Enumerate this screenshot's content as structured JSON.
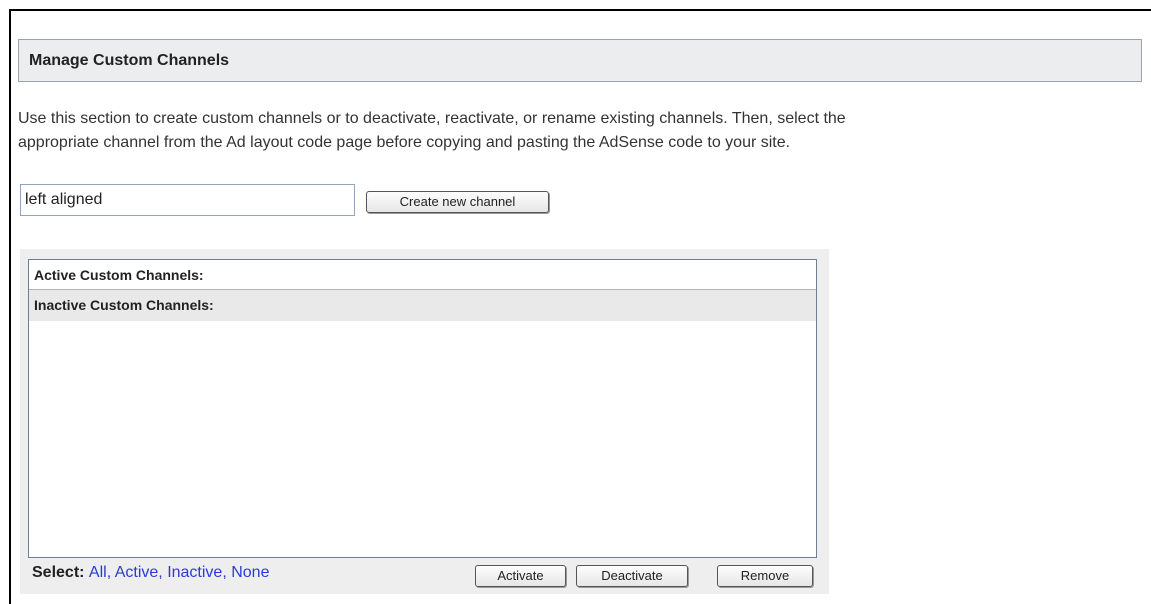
{
  "header": {
    "title": "Manage Custom Channels"
  },
  "description": {
    "line1": "Use this section to create custom channels or to deactivate, reactivate, or rename existing channels. Then, select the",
    "line2": "appropriate channel from the Ad layout code page before copying and pasting the AdSense code to your site."
  },
  "create": {
    "input_value": "left aligned",
    "button_label": "Create new channel"
  },
  "channels": {
    "active_label": "Active Custom Channels:",
    "inactive_label": "Inactive Custom Channels:"
  },
  "select": {
    "label": "Select:",
    "options": [
      "All",
      "Active",
      "Inactive",
      "None"
    ],
    "separator": ","
  },
  "actions": {
    "activate_label": "Activate",
    "deactivate_label": "Deactivate",
    "remove_label": "Remove"
  }
}
